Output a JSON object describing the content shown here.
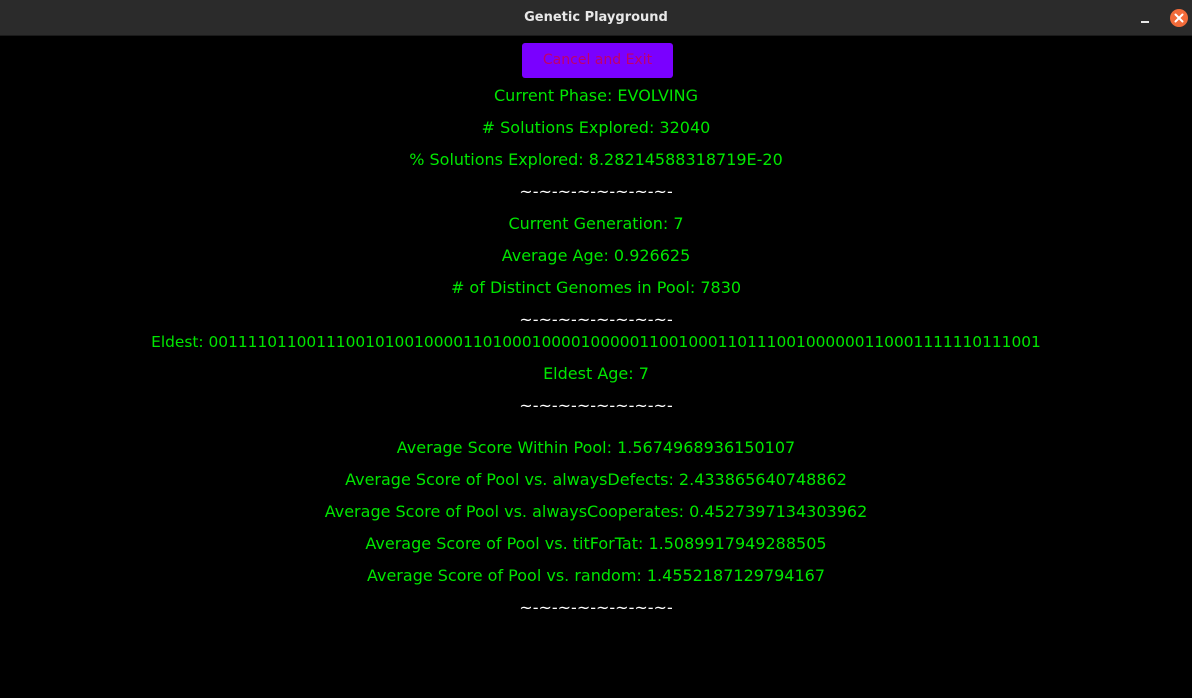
{
  "window": {
    "title": "Genetic Playground"
  },
  "controls": {
    "cancel_label": "Cancel and Exit"
  },
  "stats": {
    "phase": "Current Phase: EVOLVING",
    "solutions_explored": "# Solutions Explored: 32040",
    "percent_explored": "% Solutions Explored: 8.28214588318719E-20",
    "separator": "~-~-~-~-~-~-~-~-",
    "current_generation": "Current Generation: 7",
    "average_age": "Average Age: 0.926625",
    "distinct_genomes": "# of Distinct Genomes in Pool: 7830",
    "eldest": "Eldest: 0011110110011100101001000011010001000010000011001000110111001000000110001111110111001",
    "eldest_age": "Eldest Age: 7",
    "avg_within_pool": "Average Score Within Pool: 1.5674968936150107",
    "avg_vs_always_defects": "Average Score of Pool vs. alwaysDefects: 2.433865640748862",
    "avg_vs_always_cooperates": "Average Score of Pool vs. alwaysCooperates: 0.4527397134303962",
    "avg_vs_tit_for_tat": "Average Score of Pool vs. titForTat: 1.5089917949288505",
    "avg_vs_random": "Average Score of Pool vs. random: 1.4552187129794167"
  },
  "colors": {
    "background": "#000000",
    "text": "#00e600",
    "separator": "#ffffff",
    "button_bg": "#7a00ff",
    "button_text": "#c0006a",
    "close_button": "#f26b3a"
  },
  "icons": {
    "minimize": "minimize-icon",
    "close": "close-icon"
  }
}
